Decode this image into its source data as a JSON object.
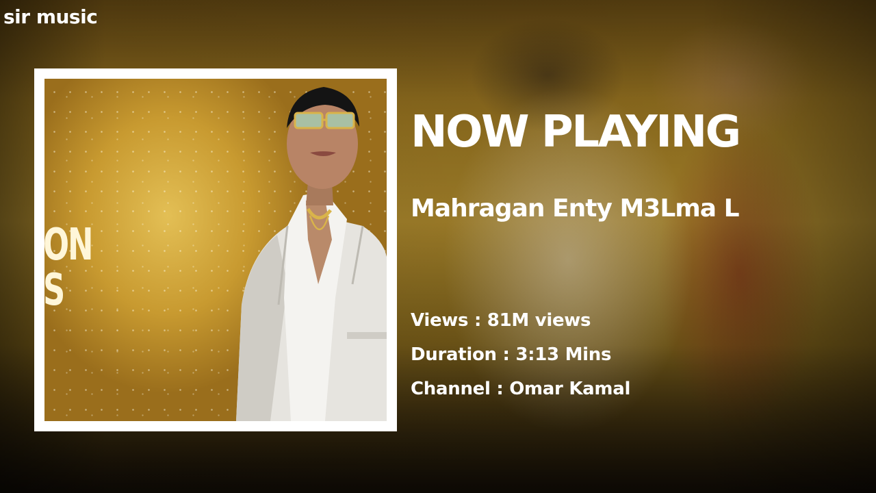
{
  "brand": {
    "name": "sir music"
  },
  "now_playing": {
    "heading": "NOW PLAYING",
    "title": "Mahragan Enty M3Lma L",
    "views_label": "Views : 81M views",
    "duration_label": "Duration : 3:13 Mins",
    "channel_label": "Channel : Omar Kamal"
  },
  "cover": {
    "partial_text": "ON\nS"
  },
  "colors": {
    "text": "#ffffff",
    "frame": "#ffffff",
    "cover_gold": "#c89a30",
    "suit": "#e9e7e2"
  }
}
